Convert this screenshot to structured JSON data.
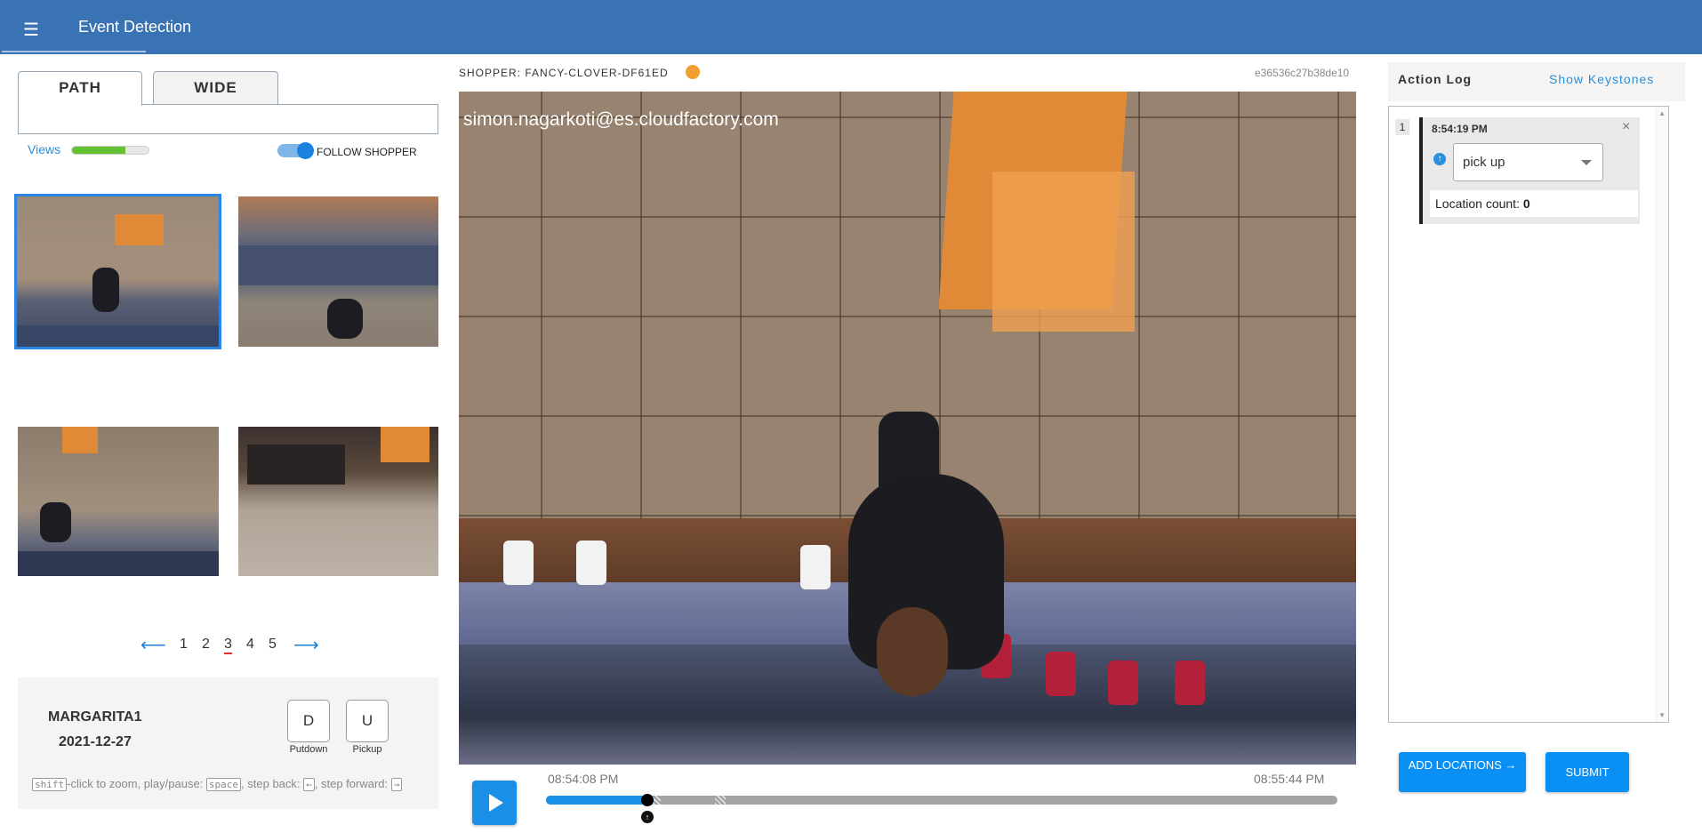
{
  "header": {
    "menu_icon": "hamburger-icon",
    "title": "Event Detection"
  },
  "left": {
    "tabs": [
      {
        "label": "PATH",
        "active": true
      },
      {
        "label": "WIDE",
        "active": false
      }
    ],
    "views_label": "Views",
    "views_progress": 0.7,
    "follow_label": "FOLLOW SHOPPER",
    "follow_on": true,
    "thumbnails": [
      "camera-1",
      "camera-2",
      "camera-3",
      "camera-4"
    ],
    "pager": {
      "prev": "⟵",
      "next": "⟶",
      "pages": [
        "1",
        "2",
        "3",
        "4",
        "5"
      ],
      "current": "3"
    },
    "info": {
      "name": "MARGARITA1",
      "date": "2021-12-27",
      "key_d": "D",
      "key_d_caption": "Putdown",
      "key_u": "U",
      "key_u_caption": "Pickup",
      "hint_shift": "shift",
      "hint_text1": "-click to zoom, play/pause: ",
      "hint_space": "space",
      "hint_text2": ", step back: ",
      "hint_back": "←",
      "hint_text3": ", step forward: ",
      "hint_forward": "→"
    }
  },
  "center": {
    "shopper_label": "SHOPPER: FANCY-CLOVER-DF61ED",
    "shopper_color": "#f0a030",
    "hash": "e36536c27b38de10",
    "watermark": "simon.nagarkoti@es.cloudfactory.com",
    "time_start": "08:54:08 PM",
    "time_end": "08:55:44 PM",
    "progress": 0.128,
    "marker_icon": "up-arrow-icon"
  },
  "right": {
    "title": "Action Log",
    "show_keystones": "Show Keystones",
    "entries": [
      {
        "index": "1",
        "time": "8:54:19 PM",
        "action": "pick up",
        "count_label": "Location count: ",
        "count_value": "0"
      }
    ],
    "add_locations": "ADD LOCATIONS →",
    "submit": "SUBMIT"
  },
  "colors": {
    "header": "#3a73b3",
    "accent": "#0a8ff5",
    "progress_green": "#63c132"
  }
}
